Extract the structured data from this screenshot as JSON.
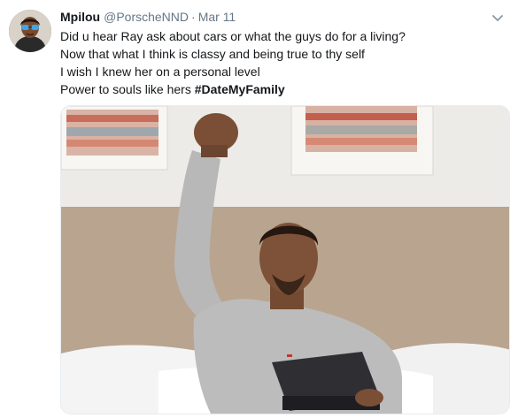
{
  "tweet": {
    "author_name": "Mpilou",
    "handle": "@PorscheNND",
    "separator": "·",
    "date": "Mar 11",
    "lines": [
      "Did u hear Ray ask about cars or what the guys do for a living?",
      "Now that what I think is classy and being true to thy self",
      "I wish I knew her on a personal level",
      "Power to souls like hers"
    ],
    "hashtag": "#DateMyFamily"
  },
  "icons": {
    "caret": "chevron-down-icon",
    "avatar": "avatar"
  },
  "colors": {
    "text": "#14171a",
    "muted": "#657786",
    "border": "#e6ecf0"
  }
}
